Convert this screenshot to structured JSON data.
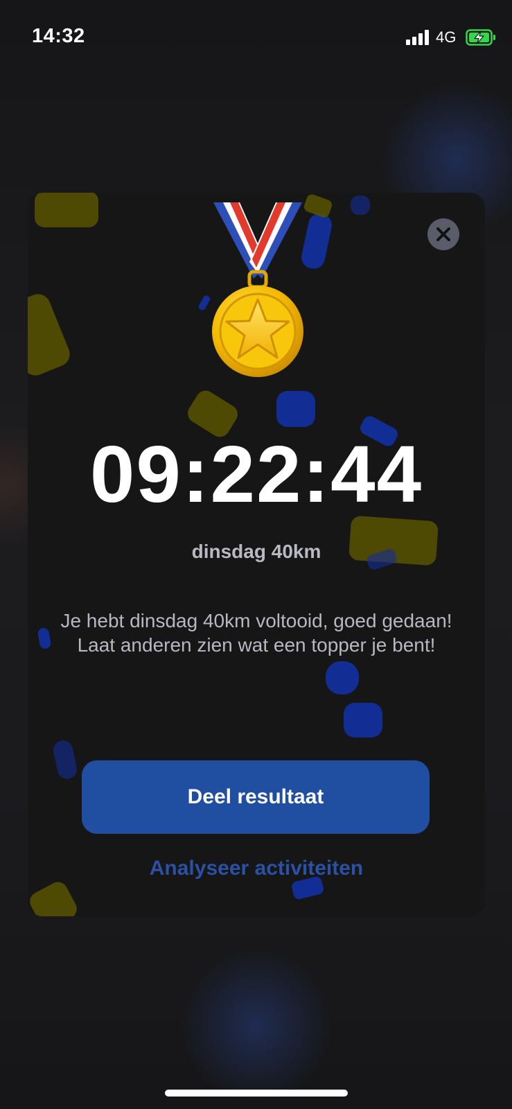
{
  "status_bar": {
    "time": "14:32",
    "network": "4G",
    "signal_bars": 4,
    "battery_state": "charging",
    "battery_color": "#32d74b"
  },
  "modal": {
    "icon": "medal-icon",
    "timer": "09:22:44",
    "activity_name": "dinsdag 40km",
    "message": "Je hebt dinsdag 40km voltooid, goed gedaan! Laat anderen zien wat een topper je bent!",
    "share_label": "Deel resultaat",
    "analyze_label": "Analyseer activiteiten"
  },
  "colors": {
    "background": "#1a1a1c",
    "modal_background": "#161617",
    "primary_button": "#204ea0",
    "link": "#2b51a6",
    "confetti_yellow": "#585400",
    "confetti_blue": "#1232aa"
  }
}
